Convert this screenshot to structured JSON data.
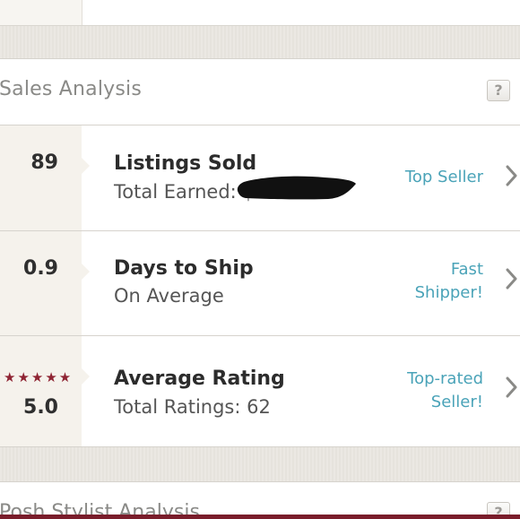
{
  "sales_analysis": {
    "title": "Sales Analysis",
    "help_label": "?",
    "rows": [
      {
        "stat": "89",
        "title": "Listings Sold",
        "subtitle": "Total Earned: $",
        "badge_line1": "Top Seller",
        "badge_line2": ""
      },
      {
        "stat": "0.9",
        "title": "Days to Ship",
        "subtitle": "On Average",
        "badge_line1": "Fast",
        "badge_line2": "Shipper!"
      },
      {
        "stat": "5.0",
        "stars": "★★★★★",
        "title": "Average Rating",
        "subtitle": "Total Ratings: 62",
        "badge_line1": "Top-rated",
        "badge_line2": "Seller!"
      }
    ]
  },
  "posh_stylist": {
    "title": "Posh Stylist Analysis",
    "help_label": "?"
  },
  "colors": {
    "accent_teal": "#4aa3b8",
    "star_red": "#8f2433",
    "brand_maroon": "#7a1d2b"
  },
  "icons": [
    "chevron-right-icon",
    "help-icon",
    "star-icon"
  ]
}
